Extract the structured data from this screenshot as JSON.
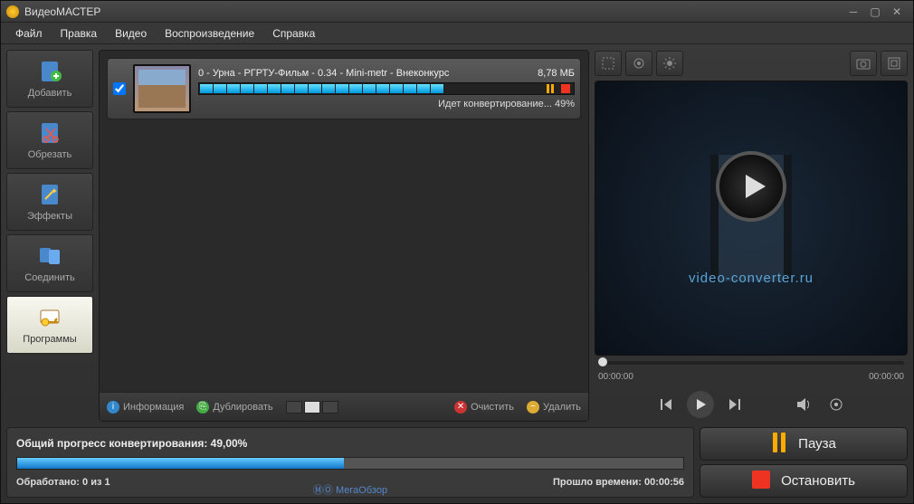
{
  "title": "ВидеоМАСТЕР",
  "menu": {
    "file": "Файл",
    "edit": "Правка",
    "video": "Видео",
    "playback": "Воспроизведение",
    "help": "Справка"
  },
  "sidebar": {
    "add": "Добавить",
    "cut": "Обрезать",
    "effects": "Эффекты",
    "join": "Соединить",
    "programs": "Программы"
  },
  "item": {
    "name": "0 - Урна - РГРТУ-Фильм - 0.34 - Mini-metr - Внеконкурс",
    "size": "8,78 МБ",
    "status": "Идет конвертирование... 49%"
  },
  "listbar": {
    "info": "Информация",
    "duplicate": "Дублировать",
    "clear": "Очистить",
    "delete": "Удалить"
  },
  "preview": {
    "url": "video-converter.ru",
    "t1": "00:00:00",
    "t2": "00:00:00"
  },
  "progress": {
    "label": "Общий прогресс конвертирования: 49,00%",
    "processed_label": "Обработано:",
    "processed_val": "0 из 1",
    "elapsed_label": "Прошло времени:",
    "elapsed_val": "00:00:56"
  },
  "actions": {
    "pause": "Пауза",
    "stop": "Остановить"
  },
  "watermark": "МегаОбзор"
}
